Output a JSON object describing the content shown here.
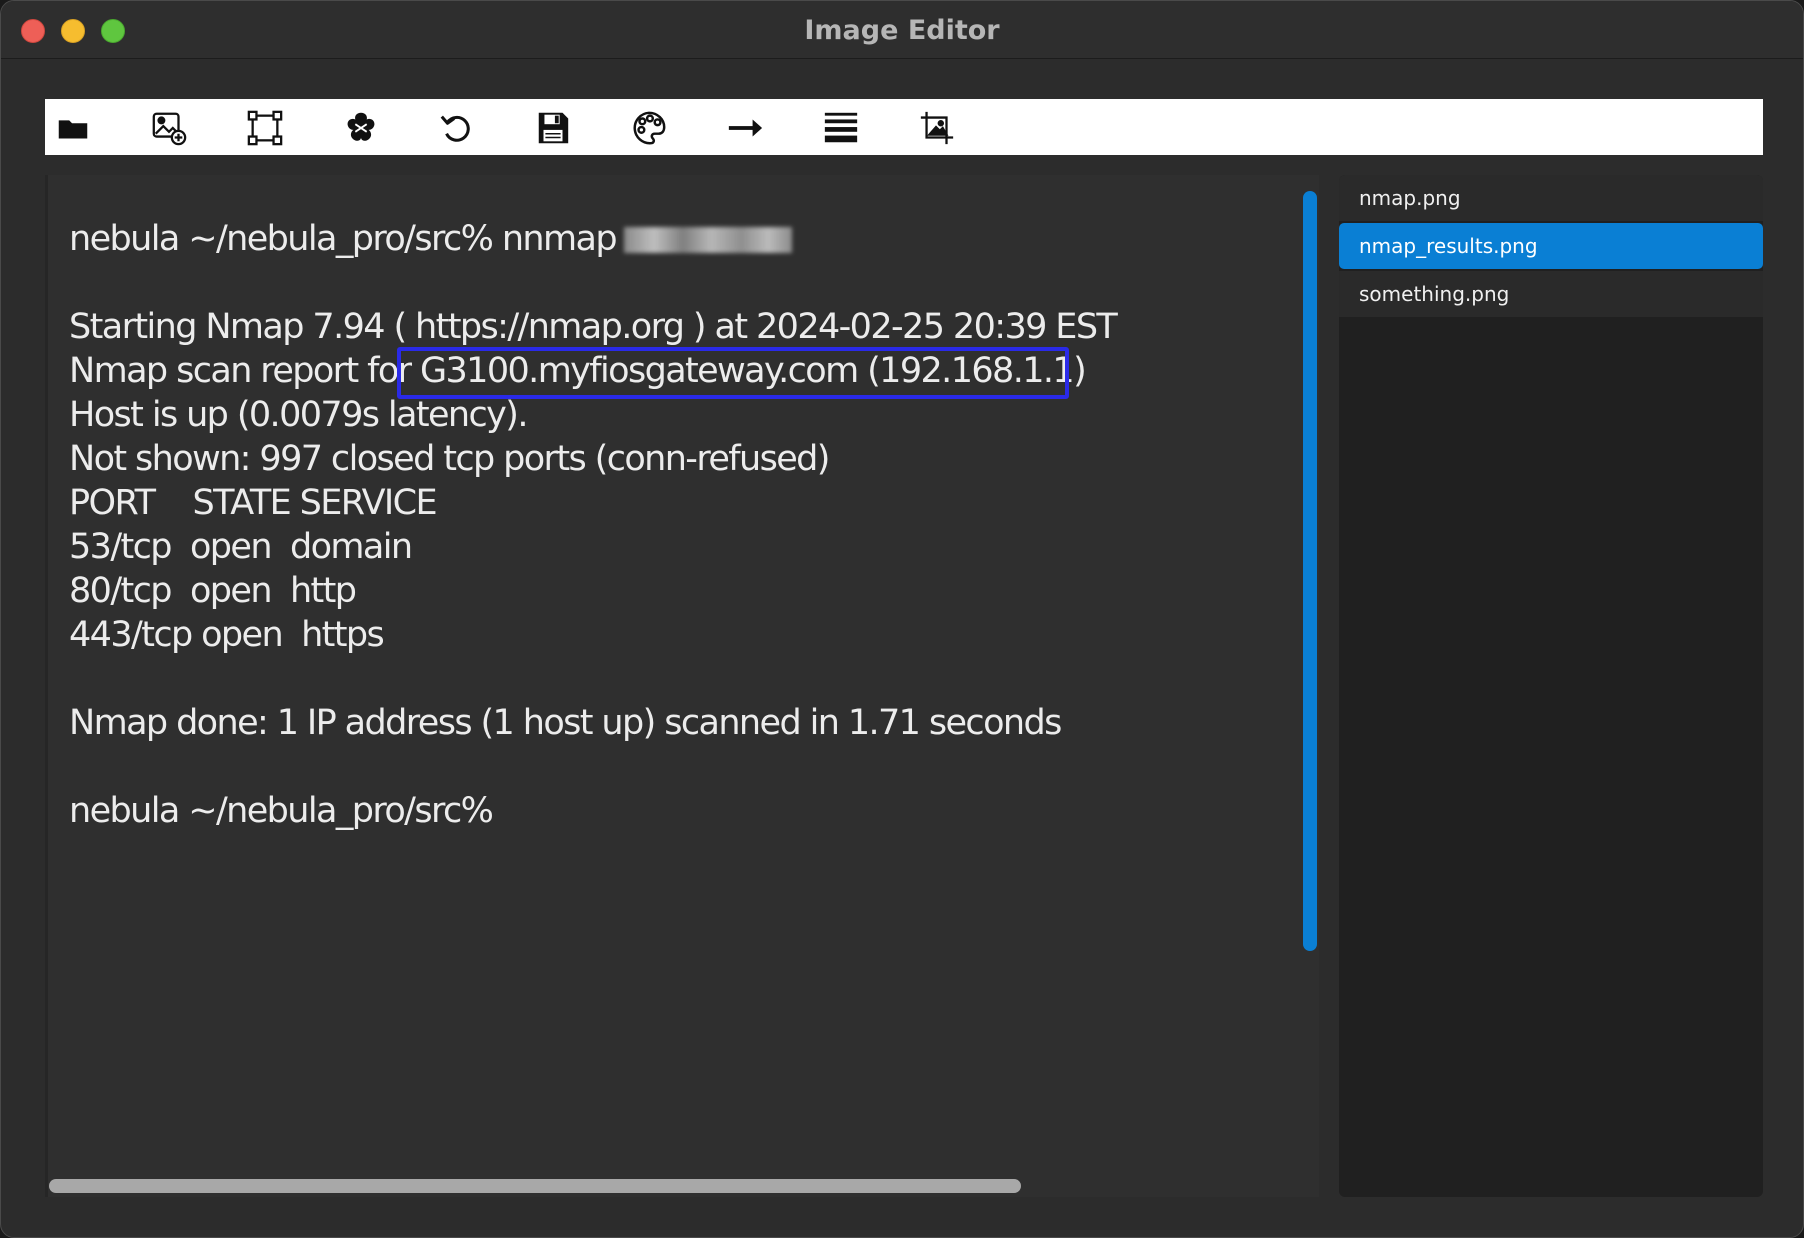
{
  "window": {
    "title": "Image Editor"
  },
  "toolbar": {
    "tools": [
      {
        "name": "open-folder-icon"
      },
      {
        "name": "add-image-icon"
      },
      {
        "name": "crop-selection-icon"
      },
      {
        "name": "paste-blob-icon"
      },
      {
        "name": "rotate-icon"
      },
      {
        "name": "save-icon"
      },
      {
        "name": "palette-icon"
      },
      {
        "name": "arrow-right-icon"
      },
      {
        "name": "lines-icon"
      },
      {
        "name": "crop-image-icon"
      }
    ]
  },
  "canvas": {
    "lines": [
      "nebula ~/nebula_pro/src% nnmap",
      "Starting Nmap 7.94 ( https://nmap.org ) at 2024-02-25 20:39 EST",
      "Nmap scan report for G3100.myfiosgateway.com (192.168.1.1)",
      "Host is up (0.0079s latency).",
      "Not shown: 997 closed tcp ports (conn-refused)",
      "PORT    STATE SERVICE",
      "53/tcp  open  domain",
      "80/tcp  open  http",
      "443/tcp open  https",
      "Nmap done: 1 IP address (1 host up) scanned in 1.71 seconds",
      "nebula ~/nebula_pro/src%"
    ]
  },
  "files": {
    "items": [
      {
        "label": "nmap.png"
      },
      {
        "label": "nmap_results.png"
      },
      {
        "label": "something.png"
      }
    ],
    "selected_index": 1
  },
  "colors": {
    "accent": "#0a7fd4",
    "highlight": "#2a2ae8"
  }
}
